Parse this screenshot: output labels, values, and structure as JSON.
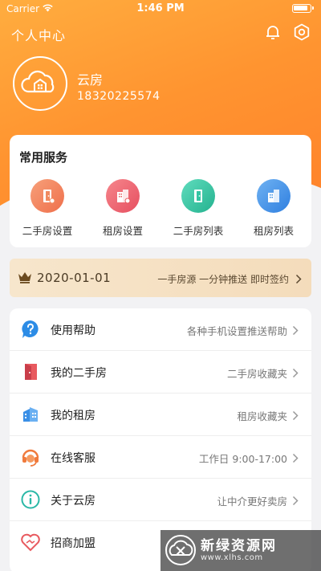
{
  "status_bar": {
    "carrier": "Carrier",
    "time": "1:46 PM"
  },
  "header": {
    "title": "个人中心"
  },
  "user": {
    "name": "云房",
    "phone": "18320225574"
  },
  "services": {
    "title": "常用服务",
    "items": [
      {
        "label": "二手房设置",
        "icon": "door-settings-icon",
        "color": "#f2845c"
      },
      {
        "label": "租房设置",
        "icon": "building-settings-icon",
        "color": "#ee5f6d"
      },
      {
        "label": "二手房列表",
        "icon": "door-list-icon",
        "color": "#34c4a3"
      },
      {
        "label": "租房列表",
        "icon": "building-list-icon",
        "color": "#3a8fe6"
      }
    ]
  },
  "vip": {
    "date": "2020-01-01",
    "promo": "一手房源 一分钟推送 即时签约",
    "icon": "crown-icon"
  },
  "menu": [
    {
      "label": "使用帮助",
      "desc": "各种手机设置推送帮助",
      "icon": "help-icon",
      "color": "#2c8ce6"
    },
    {
      "label": "我的二手房",
      "desc": "二手房收藏夹",
      "icon": "door-icon",
      "color": "#e85a5f"
    },
    {
      "label": "我的租房",
      "desc": "租房收藏夹",
      "icon": "building-icon",
      "color": "#3a8fe6"
    },
    {
      "label": "在线客服",
      "desc": "工作日 9:00-17:00",
      "icon": "support-headset-icon",
      "color": "#f07a3c"
    },
    {
      "label": "关于云房",
      "desc": "让中介更好卖房",
      "icon": "info-icon",
      "color": "#2bb8a7"
    },
    {
      "label": "招商加盟",
      "desc": "",
      "icon": "handshake-heart-icon",
      "color": "#e85a5f"
    }
  ],
  "watermark": {
    "title": "新绿资源网",
    "url": "www.xlhs.com"
  }
}
